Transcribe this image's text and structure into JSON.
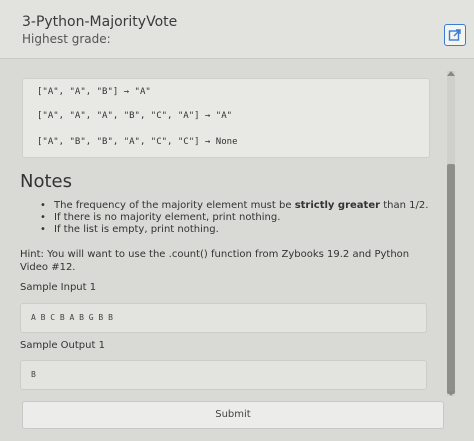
{
  "header": {
    "title": "3-Python-MajorityVote",
    "subtitle": "Highest grade:"
  },
  "examples": [
    "[\"A\", \"A\", \"B\"] → \"A\"",
    "[\"A\", \"A\", \"A\", \"B\", \"C\", \"A\"] → \"A\"",
    "[\"A\", \"B\", \"B\", \"A\", \"C\", \"C\"] → None"
  ],
  "notes": {
    "title": "Notes",
    "items": [
      {
        "before": "The frequency of the majority element must be ",
        "bold": "strictly greater",
        "after": " than 1/2."
      },
      {
        "before": "If there is no majority element, print nothing.",
        "bold": "",
        "after": ""
      },
      {
        "before": "If the list is empty, print nothing.",
        "bold": "",
        "after": ""
      }
    ]
  },
  "hint": "Hint: You will want to use the .count() function from Zybooks 19.2 and Python Video #12.",
  "sample_input": {
    "label": "Sample Input 1",
    "value": "A B C B A B G B B"
  },
  "sample_output": {
    "label": "Sample Output 1",
    "value": "B"
  },
  "submit_label": "Submit",
  "colors": {
    "accent": "#3a7bd5",
    "background": "#d9d9d6"
  }
}
